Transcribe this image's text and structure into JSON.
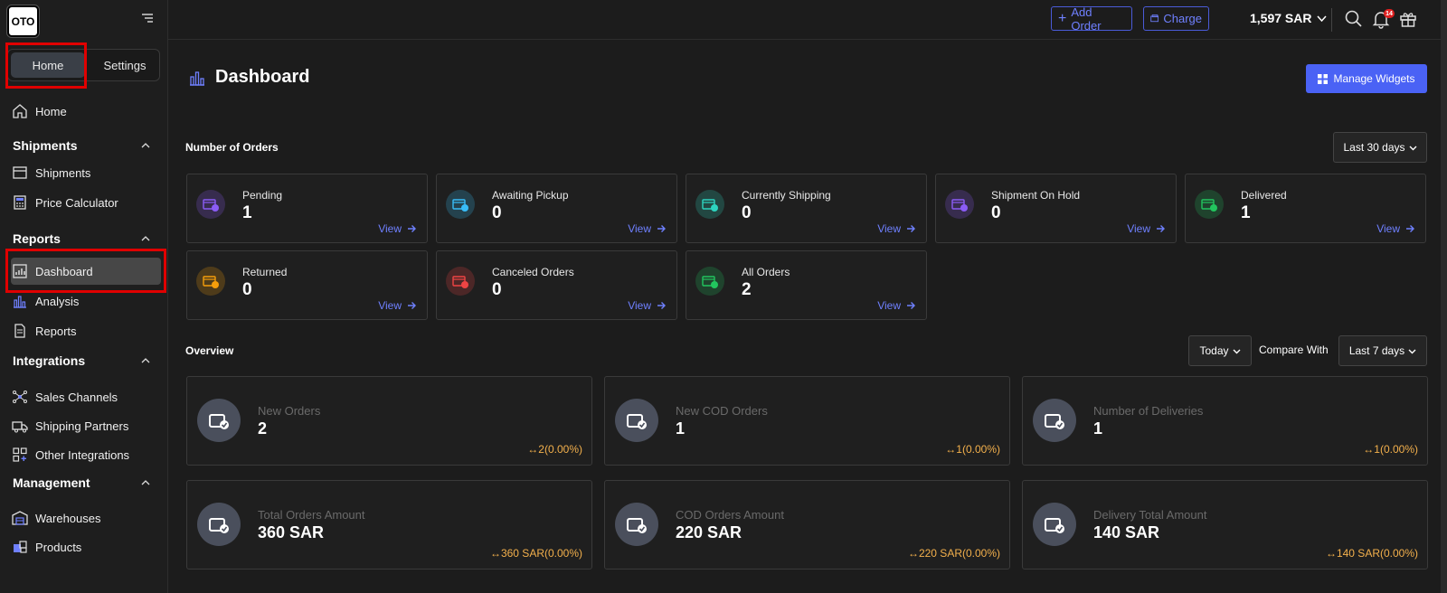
{
  "logo": "OTO",
  "sidebar": {
    "tabs": {
      "home": "Home",
      "settings": "Settings"
    },
    "home_item": "Home",
    "sections": [
      {
        "title": "Shipments",
        "items": [
          "Shipments",
          "Price Calculator"
        ]
      },
      {
        "title": "Reports",
        "items": [
          "Dashboard",
          "Analysis",
          "Reports"
        ]
      },
      {
        "title": "Integrations",
        "items": [
          "Sales Channels",
          "Shipping Partners",
          "Other Integrations"
        ]
      },
      {
        "title": "Management",
        "items": [
          "Warehouses",
          "Products"
        ]
      }
    ]
  },
  "topbar": {
    "add_order": "Add Order",
    "charge": "Charge",
    "balance": "1,597 SAR",
    "notification_count": "14"
  },
  "main": {
    "title": "Dashboard",
    "manage_widgets": "Manage Widgets",
    "orders_section": {
      "label": "Number of Orders",
      "range": "Last 30 days",
      "view_label": "View",
      "cards": [
        {
          "label": "Pending",
          "value": "1",
          "icon": "pending-icon",
          "color": "#8b5cf6"
        },
        {
          "label": "Awaiting Pickup",
          "value": "0",
          "icon": "awaiting-pickup-icon",
          "color": "#38bdf8"
        },
        {
          "label": "Currently Shipping",
          "value": "0",
          "icon": "currently-shipping-icon",
          "color": "#2dd4bf"
        },
        {
          "label": "Shipment On Hold",
          "value": "0",
          "icon": "shipment-on-hold-icon",
          "color": "#8b5cf6"
        },
        {
          "label": "Delivered",
          "value": "1",
          "icon": "delivered-icon",
          "color": "#22c55e"
        },
        {
          "label": "Returned",
          "value": "0",
          "icon": "returned-icon",
          "color": "#f59e0b"
        },
        {
          "label": "Canceled Orders",
          "value": "0",
          "icon": "canceled-orders-icon",
          "color": "#ef4444"
        },
        {
          "label": "All Orders",
          "value": "2",
          "icon": "all-orders-icon",
          "color": "#22c55e"
        }
      ]
    },
    "overview_section": {
      "label": "Overview",
      "period": "Today",
      "compare_label": "Compare With",
      "compare_range": "Last 7 days",
      "cards": [
        {
          "label": "New Orders",
          "value": "2",
          "delta": "↔2(0.00%)",
          "icon": "basket-check-icon"
        },
        {
          "label": "New COD Orders",
          "value": "1",
          "delta": "↔1(0.00%)",
          "icon": "cash-check-icon"
        },
        {
          "label": "Number of Deliveries",
          "value": "1",
          "delta": "↔1(0.00%)",
          "icon": "box-check-icon"
        },
        {
          "label": "Total Orders Amount",
          "value": "360 SAR",
          "delta": "↔360 SAR(0.00%)",
          "icon": "cart-money-icon"
        },
        {
          "label": "COD Orders Amount",
          "value": "220 SAR",
          "delta": "↔220 SAR(0.00%)",
          "icon": "card-money-icon"
        },
        {
          "label": "Delivery Total Amount",
          "value": "140 SAR",
          "delta": "↔140 SAR(0.00%)",
          "icon": "money-bag-icon"
        }
      ]
    }
  }
}
